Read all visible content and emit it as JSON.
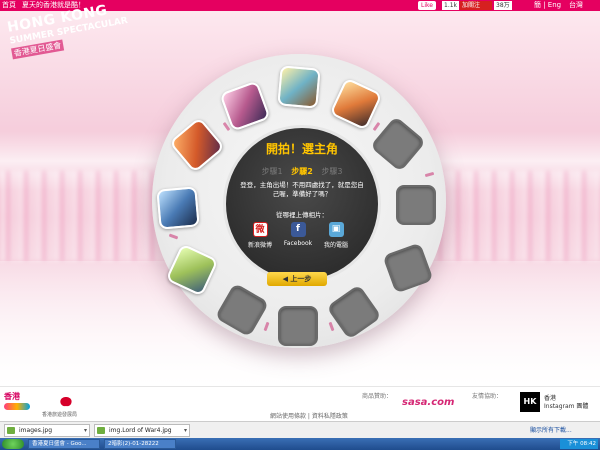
{
  "topbar": {
    "home": "首頁",
    "tagline": "夏天的香港就是酷！",
    "like_label": "Like",
    "like_count": "1.1k",
    "weibo_label": "加關注",
    "weibo_count": "38万",
    "lang": "簡 | Eng",
    "region": "台灣"
  },
  "logo": {
    "line1": "HONG KONG",
    "line2": "SUMMER SPECTACULAR",
    "line3": "香港夏日盛會"
  },
  "wizard": {
    "title": "開拍！選主角",
    "steps": [
      "步驟1",
      "步驟2",
      "步驟3"
    ],
    "active_step": 1,
    "message": "登登，主角出場！不用四處找了，就是您自己喔，準備好了嗎？",
    "ask": "從哪裡上傳相片：",
    "sources": [
      {
        "label": "新浪微博",
        "icon": "weibo-icon"
      },
      {
        "label": "Facebook",
        "icon": "facebook-icon"
      },
      {
        "label": "我的電腦",
        "icon": "computer-icon"
      }
    ],
    "back_label": "上一步"
  },
  "footer": {
    "hk_brand": "香港",
    "hktb_text": "香港旅遊發展局",
    "sponsor_label": "商品贊助：",
    "sasa": "sasa.com",
    "partner_label": "友情協助：",
    "hk_box": "HK",
    "hk_insta_line1": "香港",
    "hk_insta_line2": "Instagram 團體",
    "links": "網站使用條款  |  資料私隱政策"
  },
  "downloads": {
    "items": [
      "images.jpg",
      "img.Lord of War4.jpg"
    ],
    "show_all": "顯示所有下載..."
  },
  "taskbar": {
    "tasks": [
      "香港夏日盛會 - Goo...",
      "2暗影(2)-01-28222"
    ],
    "clock": "下午 08:42"
  }
}
